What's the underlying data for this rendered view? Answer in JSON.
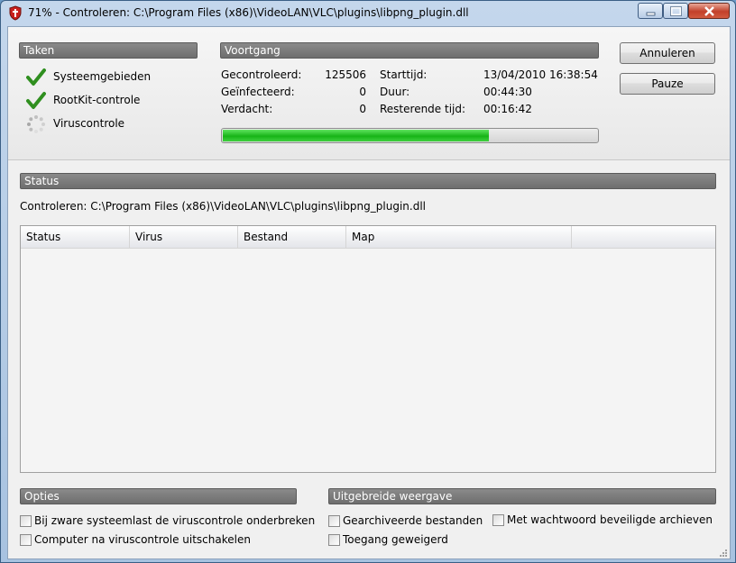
{
  "window": {
    "title": "71% - Controleren: C:\\Program Files (x86)\\VideoLAN\\VLC\\plugins\\libpng_plugin.dll",
    "icon": "shield-icon",
    "controls": [
      "minimize-icon",
      "maximize-icon",
      "close-icon"
    ]
  },
  "tasks": {
    "header": "Taken",
    "items": [
      {
        "label": "Systeemgebieden",
        "state": "done",
        "icon": "checkmark-icon"
      },
      {
        "label": "RootKit-controle",
        "state": "done",
        "icon": "checkmark-icon"
      },
      {
        "label": "Viruscontrole",
        "state": "busy",
        "icon": "spinner-icon"
      }
    ]
  },
  "progress": {
    "header": "Voortgang",
    "checked_label": "Gecontroleerd:",
    "checked_value": "125506",
    "infected_label": "Geïnfecteerd:",
    "infected_value": "0",
    "suspicious_label": "Verdacht:",
    "suspicious_value": "0",
    "start_label": "Starttijd:",
    "start_value": "13/04/2010 16:38:54",
    "duration_label": "Duur:",
    "duration_value": "00:44:30",
    "remaining_label": "Resterende tijd:",
    "remaining_value": "00:16:42",
    "percent": 71,
    "colors": {
      "bar": "#17b417"
    }
  },
  "buttons": {
    "cancel": "Annuleren",
    "pause": "Pauze"
  },
  "status": {
    "header": "Status",
    "current": "Controleren: C:\\Program Files (x86)\\VideoLAN\\VLC\\plugins\\libpng_plugin.dll",
    "columns": [
      "Status",
      "Virus",
      "Bestand",
      "Map"
    ],
    "rows": []
  },
  "options": {
    "header": "Opties",
    "items": [
      {
        "label": "Bij zware systeemlast de viruscontrole onderbreken",
        "checked": false
      },
      {
        "label": "Computer na viruscontrole uitschakelen",
        "checked": false
      }
    ]
  },
  "advanced": {
    "header": "Uitgebreide weergave",
    "items": [
      {
        "label": "Gearchiveerde bestanden",
        "checked": false
      },
      {
        "label": "Toegang geweigerd",
        "checked": false
      },
      {
        "label": "Met wachtwoord beveiligde archieven",
        "checked": false
      }
    ]
  }
}
